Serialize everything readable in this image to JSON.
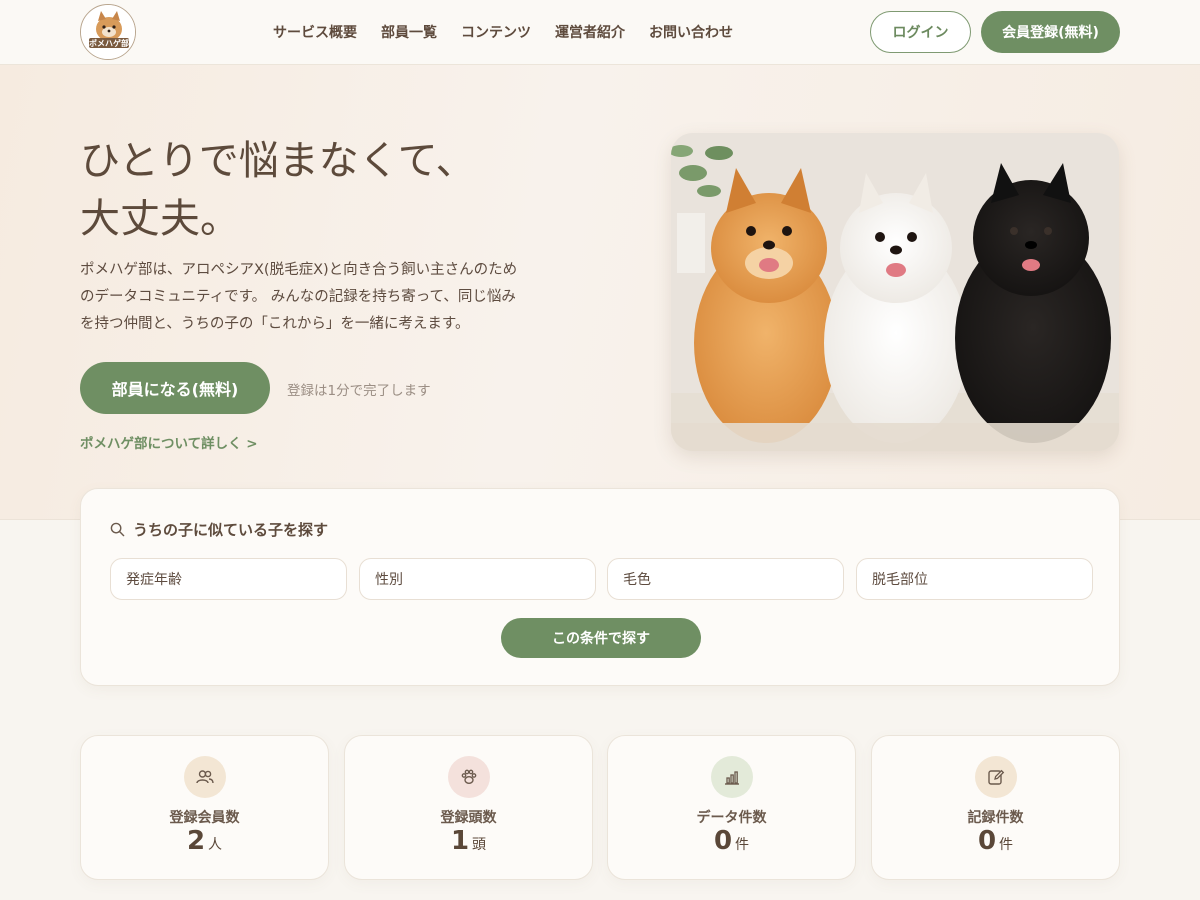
{
  "header": {
    "logo_text": "ポメハゲ部",
    "nav": [
      "サービス概要",
      "部員一覧",
      "コンテンツ",
      "運営者紹介",
      "お問い合わせ"
    ],
    "login_label": "ログイン",
    "register_label": "会員登録(無料)"
  },
  "hero": {
    "title_line1": "ひとりで悩まなくて、",
    "title_line2": "大丈夫。",
    "description": "ポメハゲ部は、アロペシアX(脱毛症X)と向き合う飼い主さんのためのデータコミュニティです。 みんなの記録を持ち寄って、同じ悩みを持つ仲間と、うちの子の「これから」を一緒に考えます。",
    "join_label": "部員になる(無料)",
    "join_note": "登録は1分で完了します",
    "about_link": "ポメハゲ部について詳しく >"
  },
  "search": {
    "title": "うちの子に似ている子を探す",
    "filters": [
      "発症年齢",
      "性別",
      "毛色",
      "脱毛部位"
    ],
    "button_label": "この条件で探す"
  },
  "stats": [
    {
      "label": "登録会員数",
      "value": "2",
      "unit": "人",
      "icon": "users-icon",
      "color": "#f3e6d4"
    },
    {
      "label": "登録頭数",
      "value": "1",
      "unit": "頭",
      "icon": "paw-icon",
      "color": "#f4e1dc"
    },
    {
      "label": "データ件数",
      "value": "0",
      "unit": "件",
      "icon": "bar-chart-icon",
      "color": "#e3ead9"
    },
    {
      "label": "記録件数",
      "value": "0",
      "unit": "件",
      "icon": "edit-icon",
      "color": "#f3e6d4"
    }
  ],
  "colors": {
    "accent": "#6f8f63",
    "text": "#5b4a3e",
    "background": "#f8f5f0"
  }
}
